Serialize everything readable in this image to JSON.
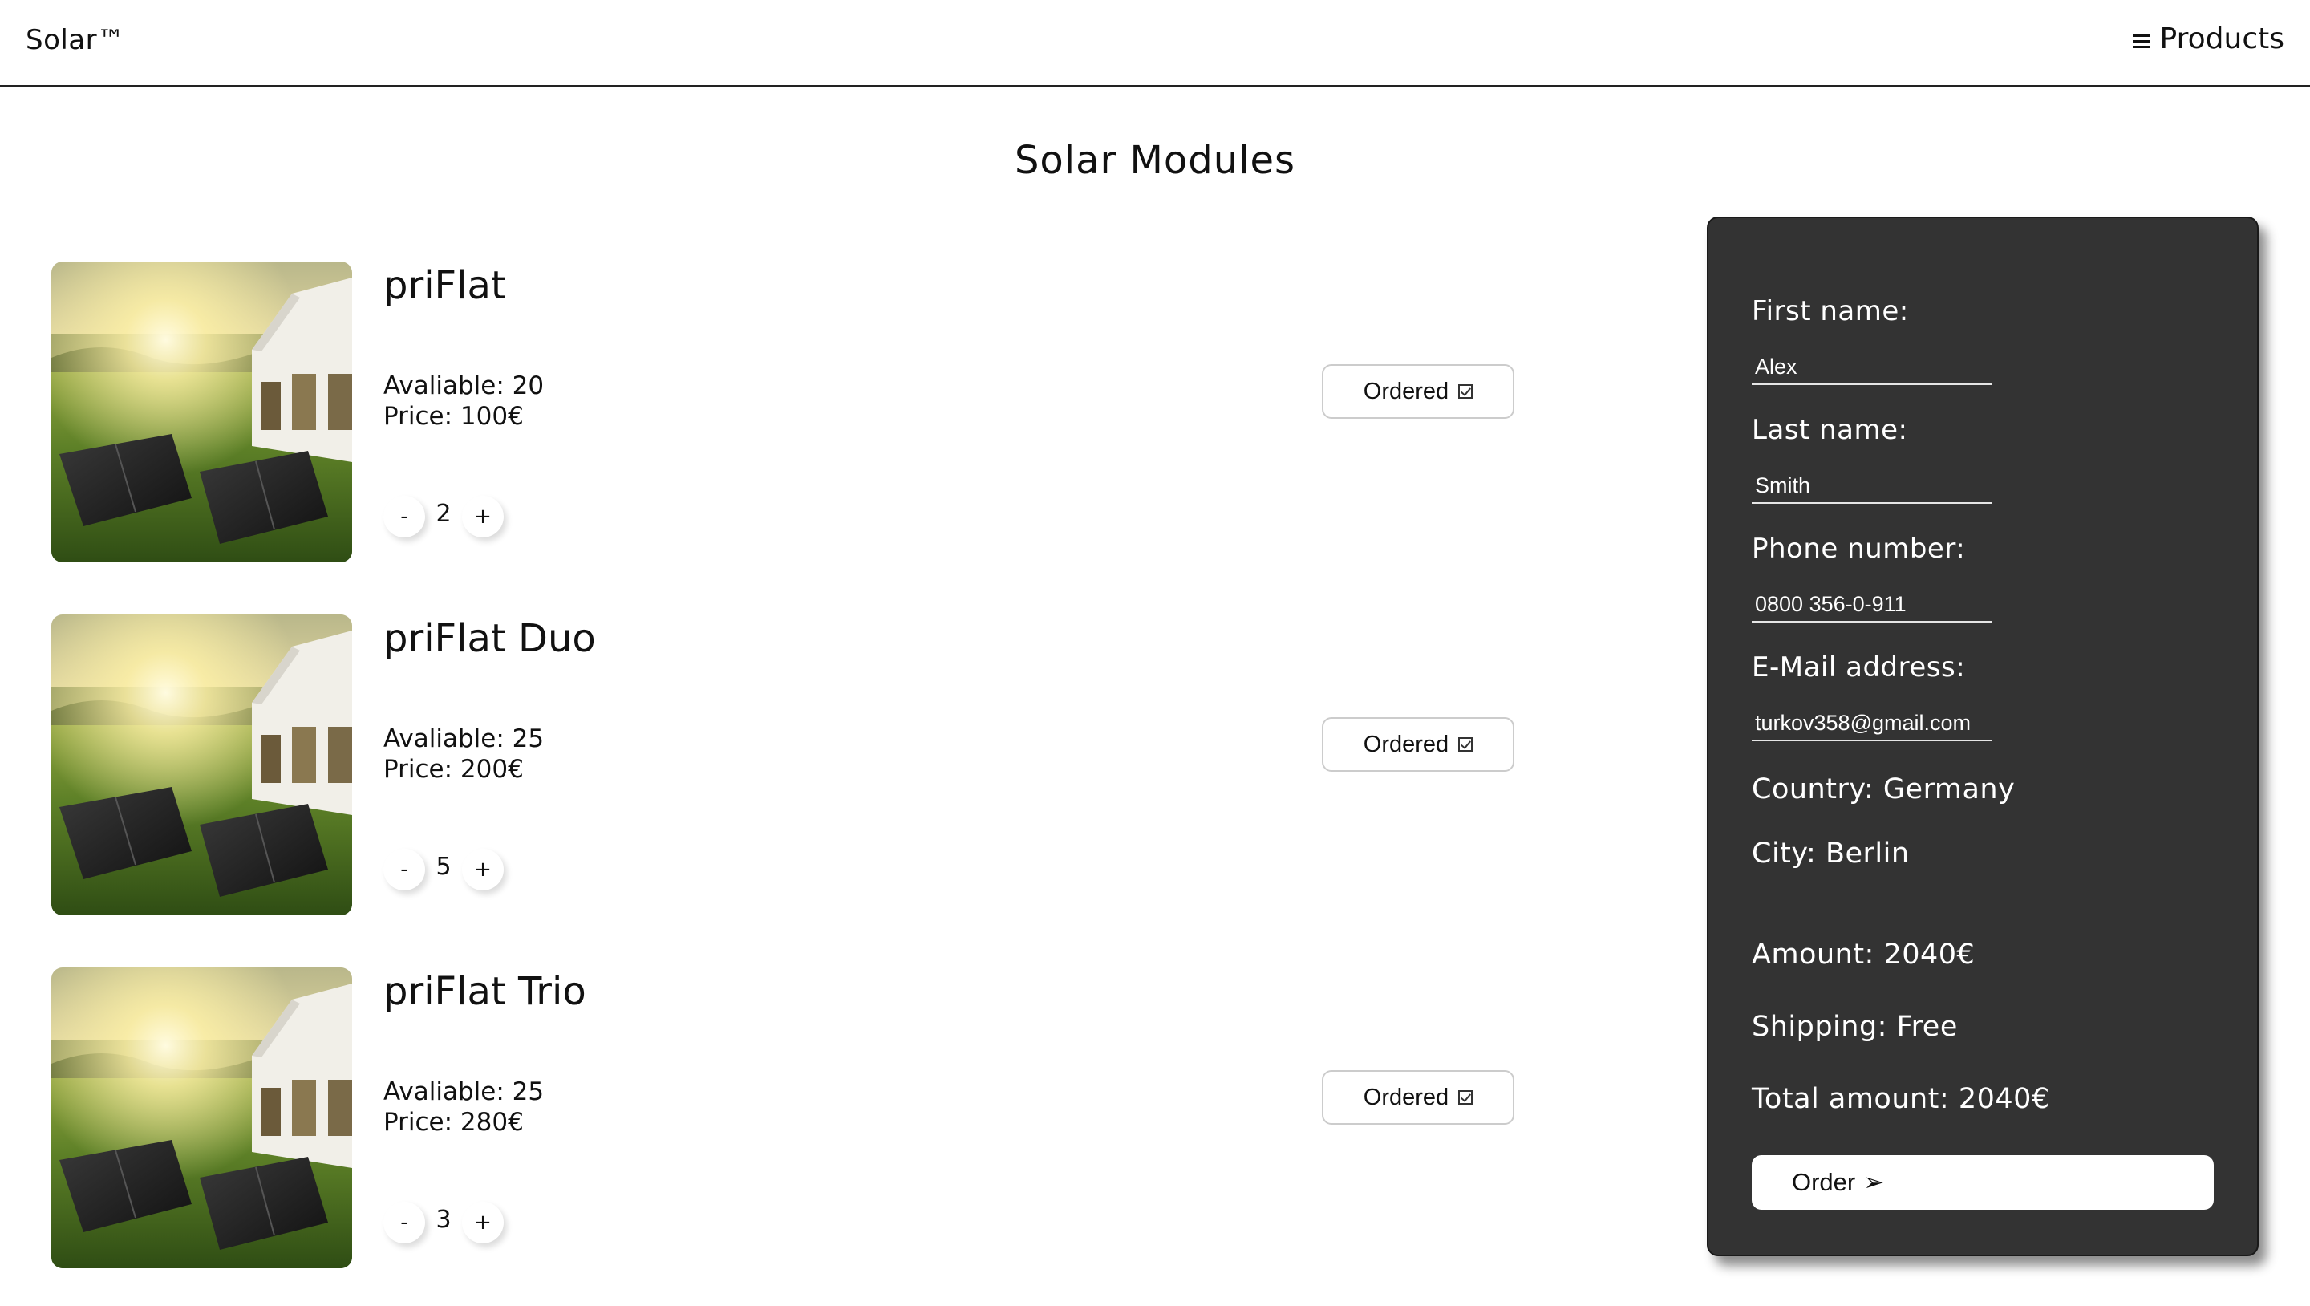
{
  "header": {
    "brand": "Solar™",
    "nav_label": "Products",
    "nav_icon": "menu-icon"
  },
  "page": {
    "title": "Solar Modules"
  },
  "products": [
    {
      "name": "priFlat",
      "available_text": "Avaliable: 20",
      "price_text": "Price: 100€",
      "quantity": "2",
      "decrement_label": "-",
      "increment_label": "+",
      "status_label": "Ordered",
      "status_icon": "checkbox-checked-icon"
    },
    {
      "name": "priFlat Duo",
      "available_text": "Avaliable: 25",
      "price_text": "Price: 200€",
      "quantity": "5",
      "decrement_label": "-",
      "increment_label": "+",
      "status_label": "Ordered",
      "status_icon": "checkbox-checked-icon"
    },
    {
      "name": "priFlat Trio",
      "available_text": "Avaliable: 25",
      "price_text": "Price: 280€",
      "quantity": "3",
      "decrement_label": "-",
      "increment_label": "+",
      "status_label": "Ordered",
      "status_icon": "checkbox-checked-icon"
    }
  ],
  "order_form": {
    "first_name_label": "First name:",
    "first_name_value": "Alex",
    "last_name_label": "Last name:",
    "last_name_value": "Smith",
    "phone_label": "Phone number:",
    "phone_value": "0800 356-0-911",
    "email_label": "E-Mail address:",
    "email_value": "turkov358@gmail.com",
    "country_text": "Country: Germany",
    "city_text": "City: Berlin",
    "amount_text": "Amount: 2040€",
    "shipping_text": "Shipping: Free",
    "total_text": "Total amount: 2040€",
    "order_button_label": "Order",
    "order_button_icon": "arrow-right-icon",
    "order_button_arrow": "➢"
  },
  "colors": {
    "panel_background": "#333333",
    "page_background": "#ffffff",
    "text": "#111111"
  }
}
